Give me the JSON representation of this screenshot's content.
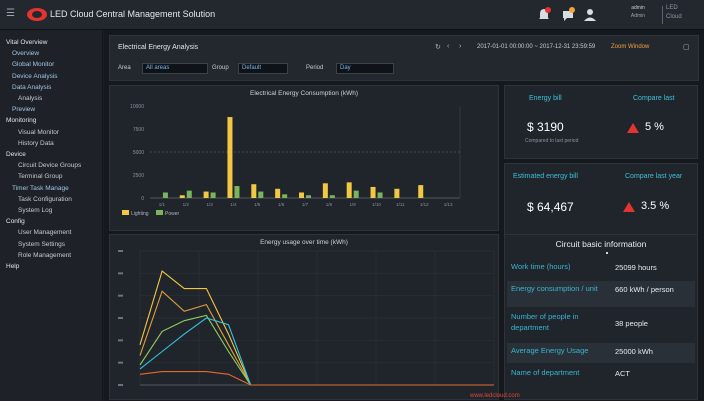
{
  "header": {
    "app_title": "LED Cloud Central Management Solution",
    "user_name": "admin",
    "user_role": "Admin",
    "brand_line1": "LED",
    "brand_line2": "Cloud"
  },
  "sidebar": {
    "items": [
      {
        "label": "Vital Overview",
        "level": 0
      },
      {
        "label": "Overview",
        "level": 1
      },
      {
        "label": "Global Monitor",
        "level": 1
      },
      {
        "label": "Device Analysis",
        "level": 1
      },
      {
        "label": "Data Analysis",
        "level": 1
      },
      {
        "label": "Analysis",
        "level": 2
      },
      {
        "label": "Preview",
        "level": 1
      },
      {
        "label": "Monitoring",
        "level": 0
      },
      {
        "label": "Visual Monitor",
        "level": 2
      },
      {
        "label": "History Data",
        "level": 2
      },
      {
        "label": "Device",
        "level": 0
      },
      {
        "label": "Circuit Device Groups",
        "level": 2
      },
      {
        "label": "Terminal Group",
        "level": 2
      },
      {
        "label": "Timer Task Manage",
        "level": 1
      },
      {
        "label": "Task Configuration",
        "level": 2
      },
      {
        "label": "System Log",
        "level": 2
      },
      {
        "label": "Config",
        "level": 0
      },
      {
        "label": "User Management",
        "level": 2
      },
      {
        "label": "System Settings",
        "level": 2
      },
      {
        "label": "Role Management",
        "level": 2
      },
      {
        "label": "Help",
        "level": 0
      }
    ]
  },
  "filter": {
    "title": "Electrical Energy Analysis",
    "range_text": "2017-01-01 00:00:00 ~ 2017-12-31 23:59:59",
    "zoom_text": "Zoom Window",
    "fields": [
      {
        "label": "Area",
        "value": "All areas"
      },
      {
        "label": "Group",
        "value": "Default"
      },
      {
        "label": "Period",
        "value": "Day"
      }
    ]
  },
  "bar_chart": {
    "title": "Electrical Energy Consumption (kWh)"
  },
  "line_chart": {
    "title": "Energy usage over time (kWh)"
  },
  "chart_data": [
    {
      "type": "bar",
      "title": "Electrical Energy Consumption (kWh)",
      "categories": [
        "1/1",
        "1/2",
        "1/3",
        "1/4",
        "1/5",
        "1/6",
        "1/7",
        "1/8",
        "1/9",
        "1/10",
        "1/11",
        "1/12",
        "1/13"
      ],
      "ylim": [
        0,
        10000
      ],
      "y_ticks": [
        "10000",
        "7500",
        "5000",
        "2500",
        "0"
      ],
      "reference_line": 5000,
      "legend": [
        "Lighting",
        "Power"
      ],
      "series": [
        {
          "name": "Lighting",
          "color": "#f2c744",
          "values": [
            0,
            300,
            700,
            8800,
            1500,
            1000,
            600,
            1600,
            1700,
            1200,
            1000,
            1400,
            0
          ]
        },
        {
          "name": "Power",
          "color": "#7ab55c",
          "values": [
            600,
            800,
            600,
            1300,
            700,
            400,
            300,
            300,
            800,
            600,
            0,
            0,
            0
          ]
        }
      ]
    },
    {
      "type": "line",
      "title": "Energy usage over time (kWh)",
      "x": [
        0,
        1,
        2,
        3,
        4,
        5,
        6,
        7,
        8,
        9,
        10,
        11,
        12,
        13,
        14,
        15,
        16
      ],
      "ylim": [
        0,
        100
      ],
      "series": [
        {
          "color": "#f2c744",
          "values": [
            30,
            85,
            72,
            72,
            38,
            0,
            0,
            0,
            0,
            0,
            0,
            0,
            0,
            0,
            0,
            0,
            0
          ]
        },
        {
          "color": "#e0a03a",
          "values": [
            22,
            70,
            55,
            60,
            30,
            0,
            0,
            0,
            0,
            0,
            0,
            0,
            0,
            0,
            0,
            0,
            0
          ]
        },
        {
          "color": "#8fcf60",
          "values": [
            15,
            40,
            48,
            52,
            25,
            0,
            0,
            0,
            0,
            0,
            0,
            0,
            0,
            0,
            0,
            0,
            0
          ]
        },
        {
          "color": "#37c1e0",
          "values": [
            12,
            25,
            38,
            50,
            45,
            0,
            0,
            0,
            0,
            0,
            0,
            0,
            0,
            0,
            0,
            0,
            0
          ]
        },
        {
          "color": "#e36a2c",
          "values": [
            8,
            10,
            10,
            10,
            8,
            0,
            0,
            0,
            0,
            0,
            0,
            0,
            0,
            0,
            0,
            0,
            0
          ]
        }
      ]
    }
  ],
  "kpis": [
    {
      "label": "Energy bill",
      "value": "$ 3190",
      "change_label": "Compare last",
      "change": "5 %",
      "sub": "Compared to last period"
    },
    {
      "label": "Estimated energy bill",
      "value": "$ 64,467",
      "change_label": "Compare last year",
      "change": "3.5 %",
      "sub": ""
    }
  ],
  "info": {
    "title": "Circuit basic information",
    "rows": [
      {
        "key": "Work time (hours)",
        "value": "25099 hours"
      },
      {
        "key": "Energy consumption / unit",
        "value": "660 kWh / person"
      },
      {
        "key": "Number of people in department",
        "value": "38 people"
      },
      {
        "key": "Average Energy Usage",
        "value": "25000 kWh"
      },
      {
        "key": "Name of department",
        "value": "ACT"
      }
    ]
  },
  "footer": {
    "text": "www.ledcloud.com"
  },
  "colors": {
    "accent": "#3ec0d8",
    "alert": "#e3342f",
    "lighting": "#f2c744",
    "power": "#7ab55c"
  }
}
